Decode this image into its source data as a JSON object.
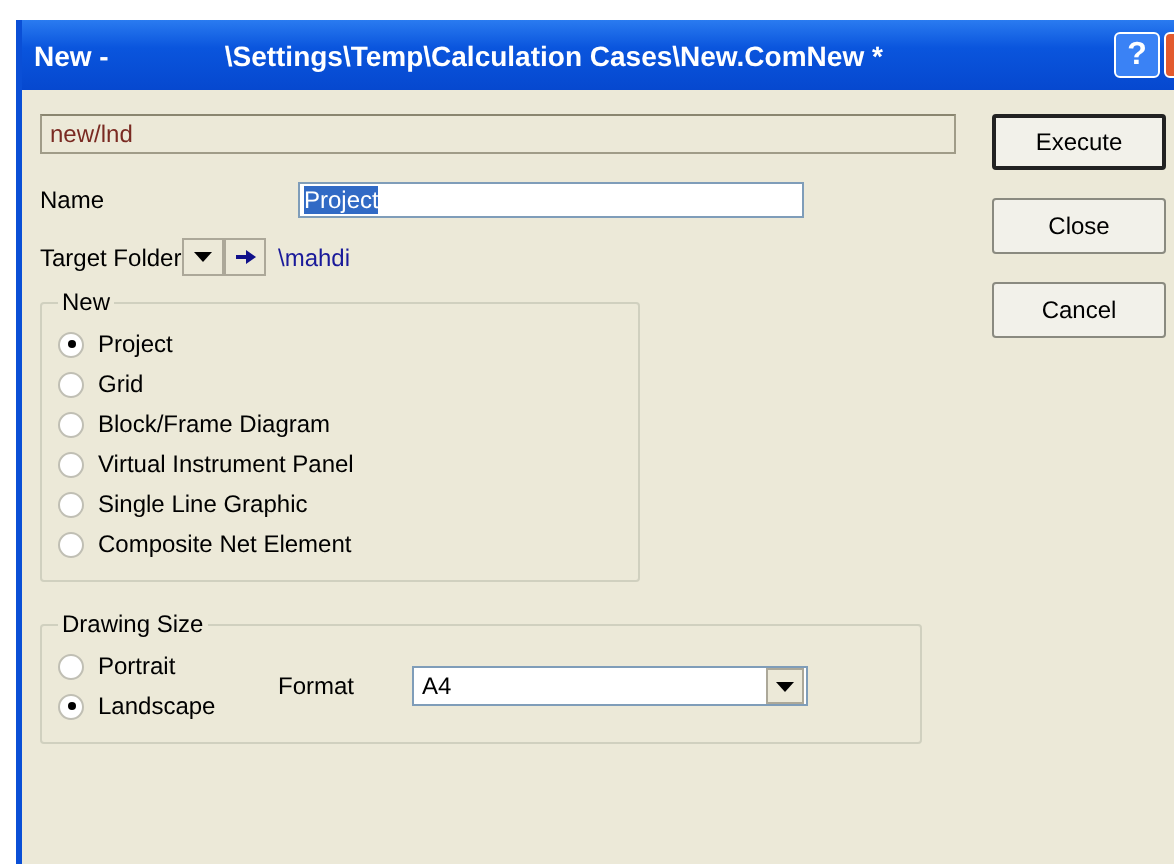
{
  "window": {
    "title_left": "New -",
    "title_path": "\\Settings\\Temp\\Calculation Cases\\New.ComNew *",
    "help_button": "?"
  },
  "path_field": {
    "value": "new/lnd"
  },
  "name_field": {
    "label": "Name",
    "value": "Project",
    "selected_text": true
  },
  "target_folder": {
    "label": "Target Folder",
    "path": "\\mahdi"
  },
  "new_group": {
    "title": "New",
    "options": [
      {
        "label": "Project",
        "selected": true
      },
      {
        "label": "Grid",
        "selected": false
      },
      {
        "label": "Block/Frame Diagram",
        "selected": false
      },
      {
        "label": "Virtual Instrument Panel",
        "selected": false
      },
      {
        "label": "Single Line Graphic",
        "selected": false
      },
      {
        "label": "Composite Net Element",
        "selected": false
      }
    ]
  },
  "drawing_size": {
    "title": "Drawing Size",
    "options": [
      {
        "label": "Portrait",
        "selected": false
      },
      {
        "label": "Landscape",
        "selected": true
      }
    ],
    "format_label": "Format",
    "format_value": "A4"
  },
  "buttons": [
    {
      "label": "Execute",
      "default": true
    },
    {
      "label": "Close",
      "default": false
    },
    {
      "label": "Cancel",
      "default": false
    }
  ]
}
